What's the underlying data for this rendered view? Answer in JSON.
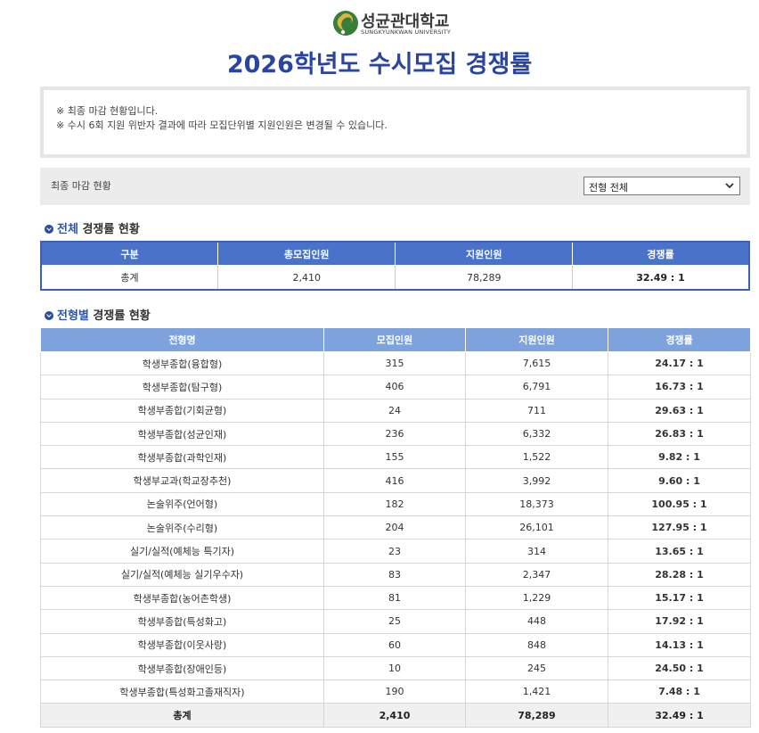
{
  "header": {
    "logo_name": "성균관대학교",
    "logo_sub": "SUNGKYUNKWAN UNIVERSITY",
    "page_title": "2026학년도  수시모집  경쟁률"
  },
  "notice": {
    "lines": [
      "※ 최종 마감 현황입니다.",
      "※ 수시 6회 지원 위반자 결과에 따라 모집단위별 지원인원은 변경될 수 있습니다."
    ]
  },
  "status": {
    "label": "최종 마감 현황",
    "filter_selected": "전형 전체"
  },
  "overall": {
    "title_highlight": "전체",
    "title_rest": " 경쟁률 현황",
    "headers": [
      "구분",
      "총모집인원",
      "지원인원",
      "경쟁률"
    ],
    "row": [
      "총계",
      "2,410",
      "78,289",
      "32.49 : 1"
    ]
  },
  "by_type": {
    "title_highlight": "전형별",
    "title_rest": " 경쟁률 현황",
    "headers": [
      "전형명",
      "모집인원",
      "지원인원",
      "경쟁률"
    ],
    "rows": [
      [
        "학생부종합(융합형)",
        "315",
        "7,615",
        "24.17 : 1"
      ],
      [
        "학생부종합(탐구형)",
        "406",
        "6,791",
        "16.73 : 1"
      ],
      [
        "학생부종합(기회균형)",
        "24",
        "711",
        "29.63 : 1"
      ],
      [
        "학생부종합(성균인재)",
        "236",
        "6,332",
        "26.83 : 1"
      ],
      [
        "학생부종합(과학인재)",
        "155",
        "1,522",
        "9.82 : 1"
      ],
      [
        "학생부교과(학교장추천)",
        "416",
        "3,992",
        "9.60 : 1"
      ],
      [
        "논술위주(언어형)",
        "182",
        "18,373",
        "100.95 : 1"
      ],
      [
        "논술위주(수리형)",
        "204",
        "26,101",
        "127.95 : 1"
      ],
      [
        "실기/실적(예체능 특기자)",
        "23",
        "314",
        "13.65 : 1"
      ],
      [
        "실기/실적(예체능 실기우수자)",
        "83",
        "2,347",
        "28.28 : 1"
      ],
      [
        "학생부종합(농어촌학생)",
        "81",
        "1,229",
        "15.17 : 1"
      ],
      [
        "학생부종합(특성화고)",
        "25",
        "448",
        "17.92 : 1"
      ],
      [
        "학생부종합(이웃사랑)",
        "60",
        "848",
        "14.13 : 1"
      ],
      [
        "학생부종합(장애인등)",
        "10",
        "245",
        "24.50 : 1"
      ],
      [
        "학생부종합(특성화고졸재직자)",
        "190",
        "1,421",
        "7.48 : 1"
      ]
    ],
    "total": [
      "총계",
      "2,410",
      "78,289",
      "32.49 : 1"
    ]
  },
  "colors": {
    "title_blue": "#2a45a0",
    "header_blue_dark": "#4a72c8",
    "header_blue_light": "#7ea3dc",
    "logo_green": "#3a7d3a"
  },
  "icons": [
    "university-logo-icon",
    "chevron-down-icon",
    "check-circle-icon"
  ]
}
